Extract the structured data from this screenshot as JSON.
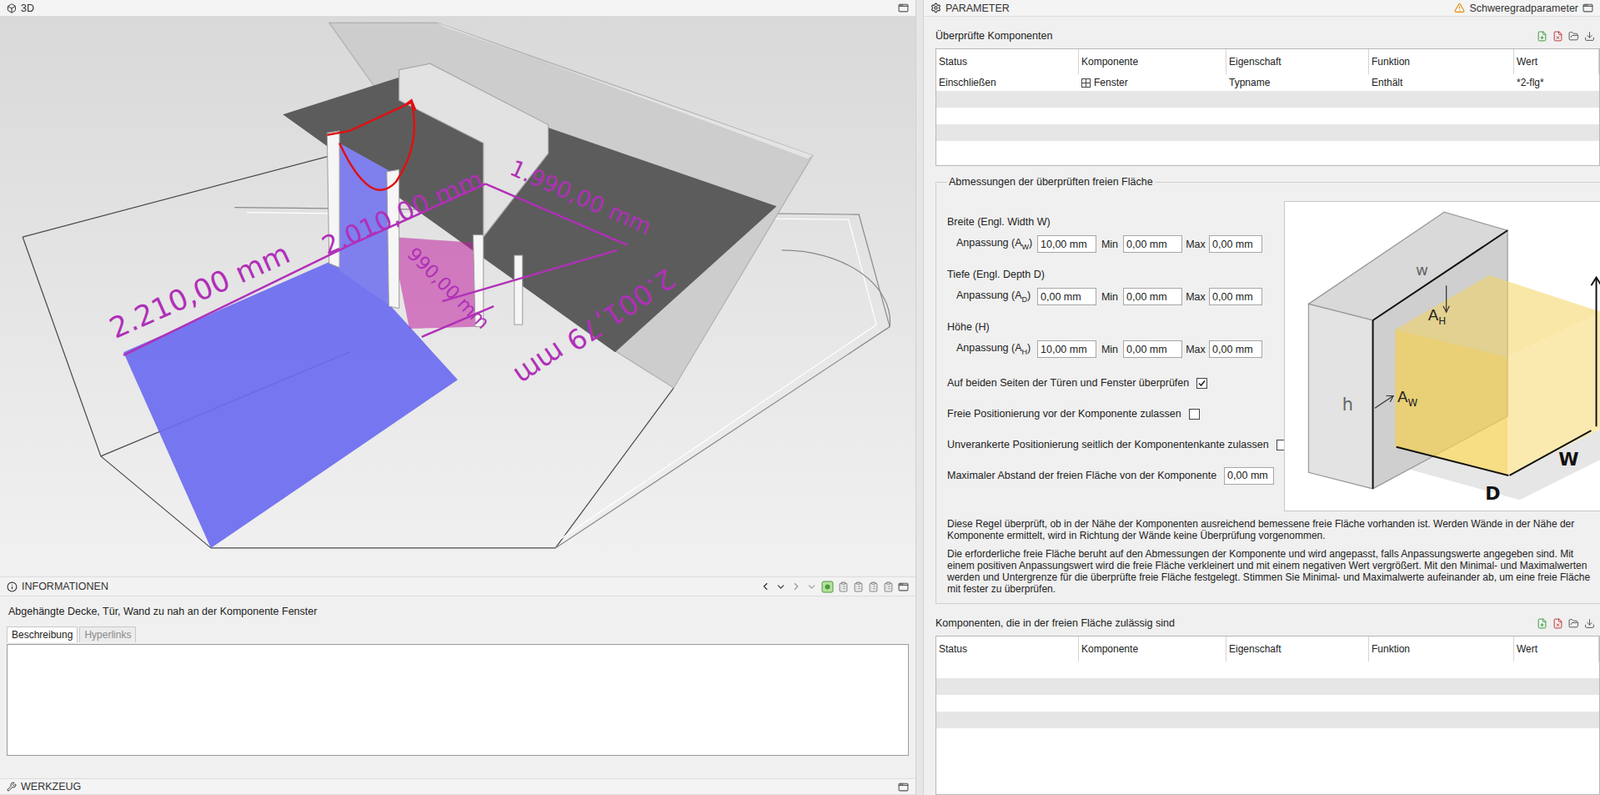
{
  "view3d": {
    "title": "3D",
    "dimensions": [
      {
        "text": "2.210,00 mm"
      },
      {
        "text": "2.010,00 mm"
      },
      {
        "text": "1.990,00 mm"
      },
      {
        "text": "2.001,79 mm"
      },
      {
        "text": "990,00 mm"
      }
    ]
  },
  "info": {
    "title": "INFORMATIONEN",
    "message": "Abgehängte Decke, Tür, Wand zu nah an der Komponente Fenster",
    "tabs": [
      {
        "label": "Beschreibung",
        "selected": true
      },
      {
        "label": "Hyperlinks",
        "selected": false
      }
    ],
    "description": ""
  },
  "tool": {
    "title": "WERKZEUG"
  },
  "parameter": {
    "title": "PARAMETER",
    "severity": "Schweregradparameter",
    "checked": {
      "title": "Überprüfte Komponenten",
      "columns": [
        "Status",
        "Komponente",
        "Eigenschaft",
        "Funktion",
        "Wert"
      ],
      "rows": [
        {
          "cells": [
            "Einschließen",
            "Fenster",
            "Typname",
            "Enthält",
            "*2-flg*"
          ]
        }
      ]
    },
    "dimensions": {
      "title": "Abmessungen der überprüften freien Fläche",
      "groups": [
        {
          "label": "Breite (Engl. Width W)",
          "prefix": "Anpassung (A",
          "sub": "W",
          "suffix": ")",
          "value": "10,00 mm",
          "minLabel": "Min",
          "min": "0,00 mm",
          "maxLabel": "Max",
          "max": "0,00 mm"
        },
        {
          "label": "Tiefe (Engl. Depth D)",
          "prefix": "Anpassung (A",
          "sub": "D",
          "suffix": ")",
          "value": "0,00 mm",
          "minLabel": "Min",
          "min": "0,00 mm",
          "maxLabel": "Max",
          "max": "0,00 mm"
        },
        {
          "label": "Höhe (H)",
          "prefix": "Anpassung (A",
          "sub": "H",
          "suffix": ")",
          "value": "10,00 mm",
          "minLabel": "Min",
          "min": "0,00 mm",
          "maxLabel": "Max",
          "max": "0,00 mm"
        }
      ],
      "options": [
        {
          "kind": "checkbox",
          "label": "Auf beiden Seiten der Türen und Fenster überprüfen",
          "checked": true
        },
        {
          "kind": "checkbox",
          "label": "Freie Positionierung vor der Komponente zulassen",
          "checked": false
        },
        {
          "kind": "checkbox",
          "label": "Unverankerte Positionierung seitlich der Komponentenkante zulassen",
          "checked": false
        },
        {
          "kind": "input",
          "label": "Maximaler Abstand der freien Fläche von der Komponente",
          "value": "0,00 mm"
        }
      ],
      "diagram": {
        "labels": [
          {
            "text": "w"
          },
          {
            "text": "A",
            "sub": "H"
          },
          {
            "text": "h"
          },
          {
            "text": "A",
            "sub": "W"
          },
          {
            "text": "D"
          },
          {
            "text": "W"
          }
        ]
      },
      "paragraphs": [
        "Diese Regel überprüft, ob in der Nähe der Komponenten ausreichend bemessene freie Fläche vorhanden ist. Werden Wände in der Nähe der Komponente ermittelt, wird in Richtung der Wände keine Überprüfung vorgenommen.",
        "Die erforderliche freie Fläche beruht auf den Abmessungen der Komponente und wird angepasst, falls Anpassungswerte angegeben sind. Mit einem positiven Anpassungswert wird die freie Fläche verkleinert und mit einem negativen Wert vergrößert. Mit den Minimal- und Maximalwerten werden und Untergrenze für die überprüfte freie Fläche festgelegt. Stimmen Sie Minimal- und Maximalwerte aufeinander ab, um eine freie Fläche mit fester zu überprüfen."
      ]
    },
    "allowed": {
      "title": "Komponenten, die in der freien Fläche zulässig sind",
      "columns": [
        "Status",
        "Komponente",
        "Eigenschaft",
        "Funktion",
        "Wert"
      ],
      "rows": []
    }
  }
}
